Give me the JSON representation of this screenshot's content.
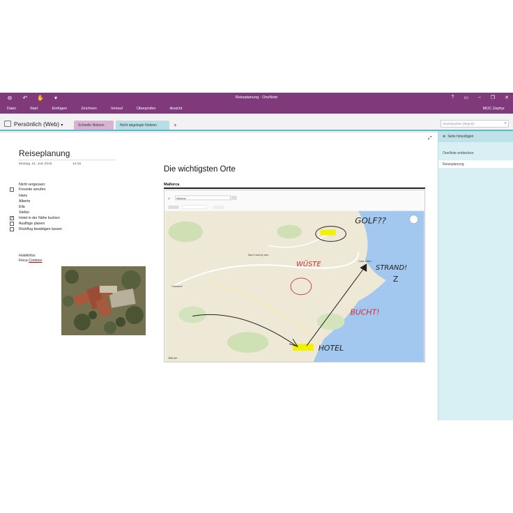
{
  "window": {
    "title": "Reiseplanung - OneNote",
    "user": "MUC Zephyr"
  },
  "ribbon": {
    "tabs": [
      "Datei",
      "Start",
      "Einfügen",
      "Zeichnen",
      "Verlauf",
      "Überprüfen",
      "Ansicht"
    ]
  },
  "notebook": {
    "name": "Persönlich (Web)",
    "sections": [
      "Schnelle Notizen",
      "Nicht abgelegte Notizen"
    ],
    "search_placeholder": "Durchsuchen (Strg+E)"
  },
  "pages_panel": {
    "add_page": "Seite hinzufügen",
    "pages": [
      "OneNote entdecken",
      "Reiseplanung"
    ]
  },
  "page": {
    "title": "Reiseplanung",
    "date": "Montag, 21. Juni 2015",
    "time": "14:16",
    "list_heading": "Nicht vergessen:",
    "todos": [
      {
        "text": "Freunde anrufen",
        "checked": false
      },
      {
        "text": "Hans",
        "checked": null
      },
      {
        "text": "Alberto",
        "checked": null
      },
      {
        "text": "Ella",
        "checked": null
      },
      {
        "text": "Stefan",
        "checked": null
      },
      {
        "text": "Hotel in der Nähe buchen",
        "checked": true
      },
      {
        "text": "Ausflüge planen",
        "checked": false
      },
      {
        "text": "Rückflug bestätigen lassen",
        "checked": false
      }
    ],
    "hotel_info_label": "Hotelinfos:",
    "hotel_name_prefix": "Finca",
    "hotel_name_link": "Contoso",
    "section_title": "Die wichtigsten Orte",
    "subsection": "Mallorca"
  },
  "map": {
    "search_value": "Mallorca",
    "handwritten": [
      "GOLF??",
      "WÜSTE",
      "STRAND!",
      "BUCHT!",
      "HOTEL"
    ],
    "colors": {
      "sea": "#a3c8ef",
      "land": "#efe9d8",
      "ink_red": "#d0303a",
      "ink_black": "#222222",
      "highlight": "#f2f200"
    }
  },
  "colors": {
    "accent": "#80397b",
    "section_pink": "#d9b3d4",
    "section_teal": "#b9dde4",
    "panel": "#d8eff3"
  }
}
